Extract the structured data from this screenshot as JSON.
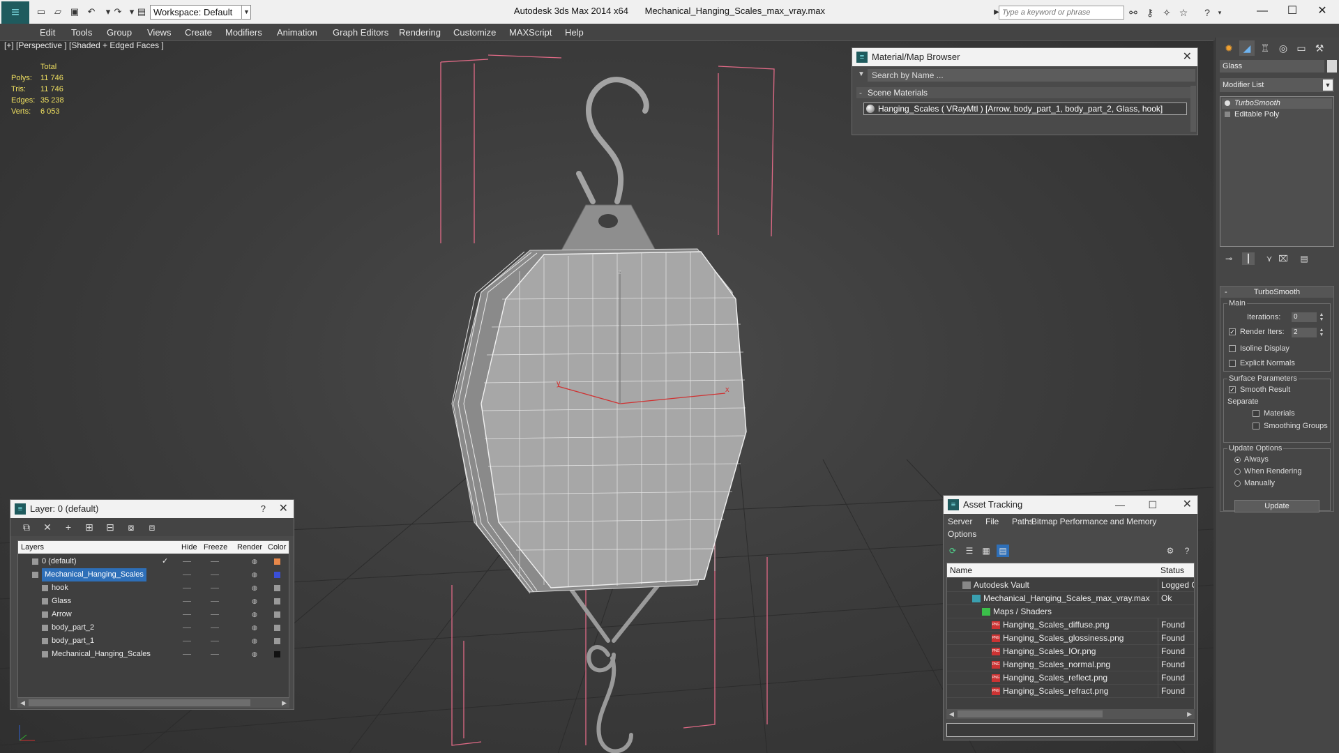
{
  "title_bar": {
    "app_name": "Autodesk 3ds Max  2014 x64",
    "file_name": "Mechanical_Hanging_Scales_max_vray.max",
    "workspace_label": "Workspace: Default",
    "search_placeholder": "Type a keyword or phrase"
  },
  "menu": [
    "Edit",
    "Tools",
    "Group",
    "Views",
    "Create",
    "Modifiers",
    "Animation",
    "Graph Editors",
    "Rendering",
    "Customize",
    "MAXScript",
    "Help"
  ],
  "viewport": {
    "label": "[+] [Perspective ] [Shaded + Edged Faces ]",
    "stats_header": "Total",
    "stats": [
      {
        "key": "Polys:",
        "value": "11 746"
      },
      {
        "key": "Tris:",
        "value": "11 746"
      },
      {
        "key": "Edges:",
        "value": "35 238"
      },
      {
        "key": "Verts:",
        "value": "6 053"
      }
    ]
  },
  "material_browser": {
    "title": "Material/Map Browser",
    "search_placeholder": "Search by Name ...",
    "section": "Scene Materials",
    "material": "Hanging_Scales  ( VRayMtl ) [Arrow, body_part_1, body_part_2, Glass, hook]"
  },
  "command_panel": {
    "object_name": "Glass",
    "modifier_list": "Modifier List",
    "stack": [
      "TurboSmooth",
      "Editable Poly"
    ],
    "turbosmooth": {
      "title": "TurboSmooth",
      "main": "Main",
      "iterations_label": "Iterations:",
      "iterations": "0",
      "render_iters_label": "Render Iters:",
      "render_iters": "2",
      "isoline": "Isoline Display",
      "explicit_normals": "Explicit Normals",
      "surface_params": "Surface Parameters",
      "smooth_result": "Smooth Result",
      "separate": "Separate",
      "materials": "Materials",
      "smoothing_groups": "Smoothing Groups",
      "update_options": "Update Options",
      "always": "Always",
      "when_rendering": "When Rendering",
      "manually": "Manually",
      "update_button": "Update"
    }
  },
  "layer_panel": {
    "title": "Layer: 0 (default)",
    "help": "?",
    "columns": [
      "Layers",
      "Hide",
      "Freeze",
      "Render",
      "Color"
    ],
    "rows": [
      {
        "name": "0 (default)",
        "indent": 0,
        "color": "#e8884a"
      },
      {
        "name": "Mechanical_Hanging_Scales",
        "indent": 0,
        "color": "#3a4fd8"
      },
      {
        "name": "hook",
        "indent": 1,
        "color": "#9a9a9a"
      },
      {
        "name": "Glass",
        "indent": 1,
        "color": "#9a9a9a"
      },
      {
        "name": "Arrow",
        "indent": 1,
        "color": "#9a9a9a"
      },
      {
        "name": "body_part_2",
        "indent": 1,
        "color": "#9a9a9a"
      },
      {
        "name": "body_part_1",
        "indent": 1,
        "color": "#9a9a9a"
      },
      {
        "name": "Mechanical_Hanging_Scales",
        "indent": 1,
        "color": "#111111"
      }
    ]
  },
  "asset_tracking": {
    "title": "Asset Tracking",
    "menu": [
      "Server",
      "File",
      "Paths",
      "Bitmap Performance and Memory",
      "Options"
    ],
    "columns": [
      "Name",
      "Status"
    ],
    "rows": [
      {
        "name": "Autodesk Vault",
        "status": "Logged O",
        "indent": 1
      },
      {
        "name": "Mechanical_Hanging_Scales_max_vray.max",
        "status": "Ok",
        "indent": 2
      },
      {
        "name": "Maps / Shaders",
        "status": "",
        "indent": 3
      },
      {
        "name": "Hanging_Scales_diffuse.png",
        "status": "Found",
        "indent": 4
      },
      {
        "name": "Hanging_Scales_glossiness.png",
        "status": "Found",
        "indent": 4
      },
      {
        "name": "Hanging_Scales_IOr.png",
        "status": "Found",
        "indent": 4
      },
      {
        "name": "Hanging_Scales_normal.png",
        "status": "Found",
        "indent": 4
      },
      {
        "name": "Hanging_Scales_reflect.png",
        "status": "Found",
        "indent": 4
      },
      {
        "name": "Hanging_Scales_refract.png",
        "status": "Found",
        "indent": 4
      }
    ]
  },
  "gizmo_labels": {
    "x": "x",
    "y": "y",
    "z": "z"
  }
}
